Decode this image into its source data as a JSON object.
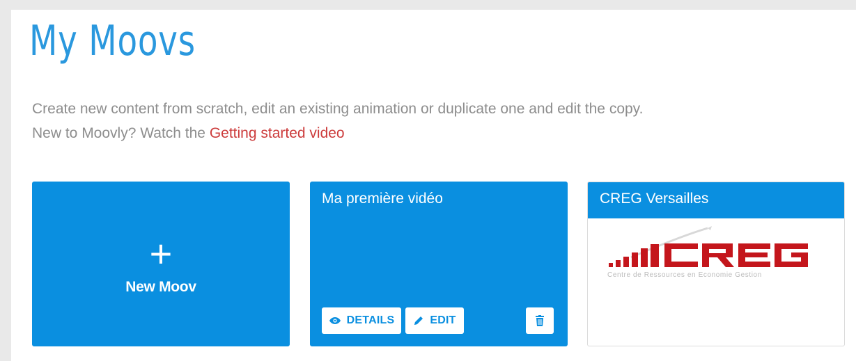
{
  "header": {
    "title": "My Moovs",
    "intro_line1": "Create new content from scratch, edit an existing animation or duplicate one and edit the copy.",
    "intro_line2_prefix": "New to Moovly? Watch the ",
    "intro_link": "Getting started video"
  },
  "cards": {
    "new_moov": {
      "icon": "plus-icon",
      "plus_glyph": "+",
      "label": "New Moov"
    },
    "video": {
      "title": "Ma première vidéo",
      "details_label": "DETAILS",
      "edit_label": "EDIT",
      "details_icon": "eye-icon",
      "edit_icon": "pencil-icon",
      "delete_icon": "trash-icon"
    },
    "creg": {
      "title": "CREG Versailles",
      "logo_text": "CREG",
      "logo_subtitle": "Centre de Ressources en Economie Gestion"
    }
  },
  "colors": {
    "accent": "#0a8fe0",
    "title": "#2a98de",
    "link": "#cc3b3b",
    "text_muted": "#8d8d8d",
    "logo_red": "#c4161c"
  }
}
